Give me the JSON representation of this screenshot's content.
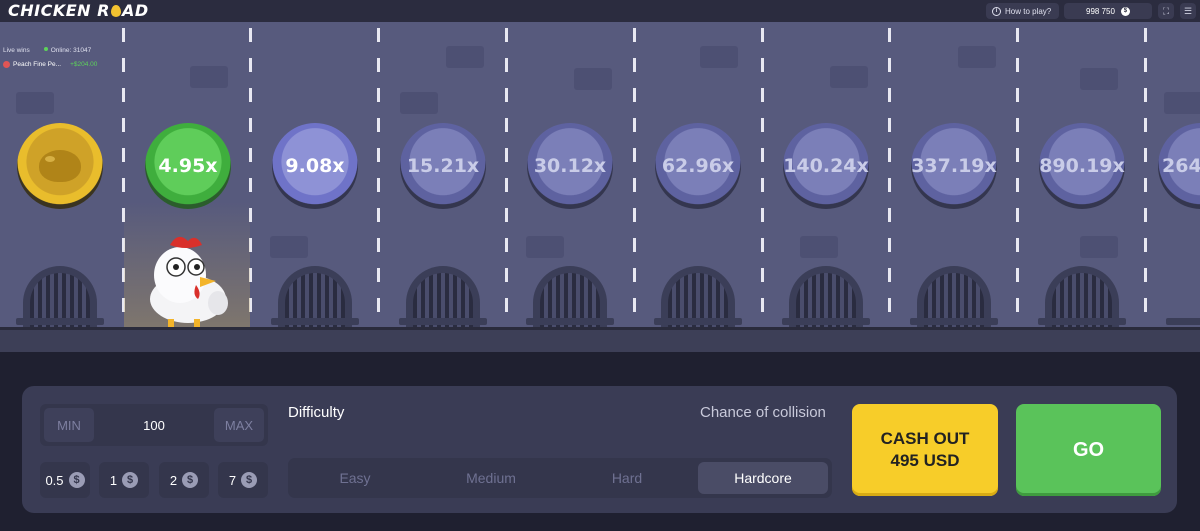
{
  "header": {
    "logo_part1": "CHICKEN R",
    "logo_part2": "AD",
    "how_to_play": "How to play?",
    "balance": "998 750",
    "currency_icon": "$"
  },
  "live": {
    "label": "Live wins",
    "online": "Online: 31047",
    "winner_name": "Peach Fine Pe...",
    "winner_amount": "+$204.00"
  },
  "lanes": [
    {
      "multiplier": "",
      "state": "passed"
    },
    {
      "multiplier": "4.95x",
      "state": "current"
    },
    {
      "multiplier": "9.08x",
      "state": "next"
    },
    {
      "multiplier": "15.21x",
      "state": "upcoming"
    },
    {
      "multiplier": "30.12x",
      "state": "upcoming"
    },
    {
      "multiplier": "62.96x",
      "state": "upcoming"
    },
    {
      "multiplier": "140.24x",
      "state": "upcoming"
    },
    {
      "multiplier": "337.19x",
      "state": "upcoming"
    },
    {
      "multiplier": "890.19x",
      "state": "upcoming"
    },
    {
      "multiplier": "264",
      "state": "upcoming"
    }
  ],
  "controls": {
    "min": "MIN",
    "bet": "100",
    "max": "MAX",
    "quick_bets": [
      "0.5",
      "1",
      "2",
      "7"
    ],
    "dollar": "$",
    "difficulty_label": "Difficulty",
    "collision_label": "Chance of collision",
    "difficulties": [
      "Easy",
      "Medium",
      "Hard",
      "Hardcore"
    ],
    "selected_difficulty": "Hardcore",
    "cash_out_line1": "CASH OUT",
    "cash_out_line2": "495 USD",
    "go": "GO"
  },
  "colors": {
    "cash_out": "#f7cd29",
    "go": "#5ac35a",
    "multiplier_reached": "#3fae3d",
    "passed_coin": "#e9bd2c"
  }
}
